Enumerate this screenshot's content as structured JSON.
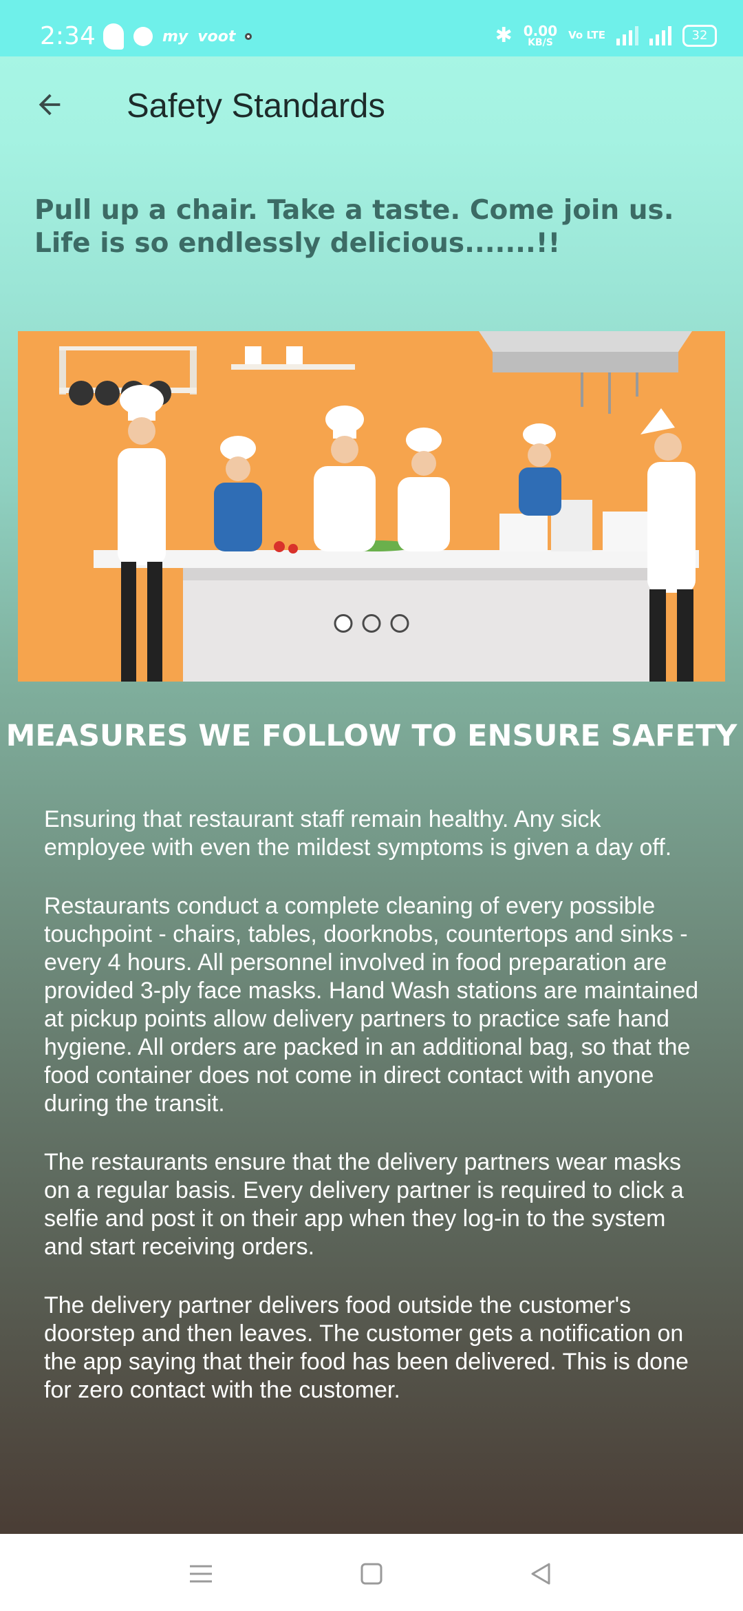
{
  "status_bar": {
    "time": "2:34",
    "net_speed_value": "0.00",
    "net_speed_unit": "KB/S",
    "volte": "Vo LTE",
    "network": "4G",
    "battery": "32",
    "left_icons": [
      "swiggy-icon",
      "jio-icon",
      "myjio-icon",
      "voot-icon",
      "notification-dot"
    ]
  },
  "header": {
    "back_icon": "arrow-left-icon",
    "title": "Safety Standards"
  },
  "tagline": "Pull up a chair. Take a taste. Come join us. Life is so endlessly delicious.......!!",
  "carousel": {
    "image": "chefs-in-kitchen-illustration",
    "slide_count": 3,
    "active_index": 0
  },
  "section": {
    "heading": "MEASURES WE FOLLOW TO ENSURE SAFETY",
    "paragraphs": [
      "Ensuring that restaurant staff remain healthy. Any sick employee with even the mildest symptoms is given a day off.",
      "Restaurants conduct a complete cleaning of every possible touchpoint - chairs, tables, doorknobs, countertops and sinks - every 4 hours. All personnel involved in food preparation are provided 3-ply face masks. Hand Wash stations are maintained at pickup points allow delivery partners to practice safe hand hygiene. All orders are packed in an additional bag, so that the food container does not come in direct contact with anyone during the transit.",
      "The restaurants ensure that the delivery partners wear masks on a regular basis. Every delivery partner is required to click a selfie and post it on their app when they log-in to the system and start receiving orders.",
      "The delivery partner delivers food outside the customer's doorstep and then leaves. The customer gets a notification on the app saying that their food has been delivered. This is done for zero contact with the customer."
    ]
  },
  "nav_bar": {
    "icons": [
      "menu-icon",
      "home-square-icon",
      "back-triangle-icon"
    ]
  },
  "colors": {
    "status_bar": "#6ff0ea",
    "gradient_top": "#a8f7e6",
    "gradient_bottom": "#4a3d35",
    "title_text": "#1d2b2a",
    "tagline_text": "#3c6b65",
    "banner_bg": "#f6a44d"
  }
}
